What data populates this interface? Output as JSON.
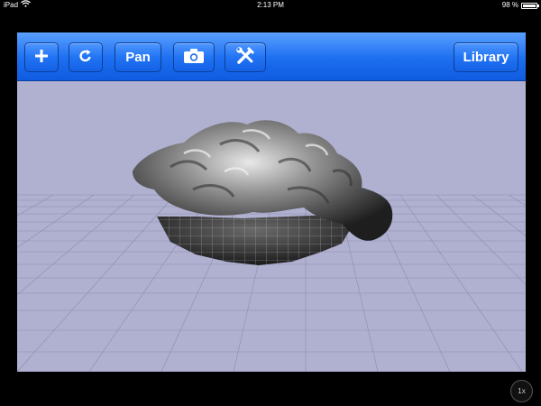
{
  "status": {
    "device": "iPad",
    "time": "2:13 PM",
    "battery": "98 %",
    "battery_level": 0.98,
    "wifi_icon": "wifi-icon"
  },
  "toolbar": {
    "add_icon": "plus-icon",
    "reset_icon": "rotate-icon",
    "pan_label": "Pan",
    "snapshot_icon": "camera-icon",
    "tools_icon": "tools-icon",
    "library_label": "Library"
  },
  "viewport": {
    "background": "#b0b0d1",
    "model": "3D rock mesh",
    "grid": true
  },
  "zoom": "1x",
  "colors": {
    "toolbar": "#1d6ef0",
    "viewport": "#b0b0d1"
  }
}
